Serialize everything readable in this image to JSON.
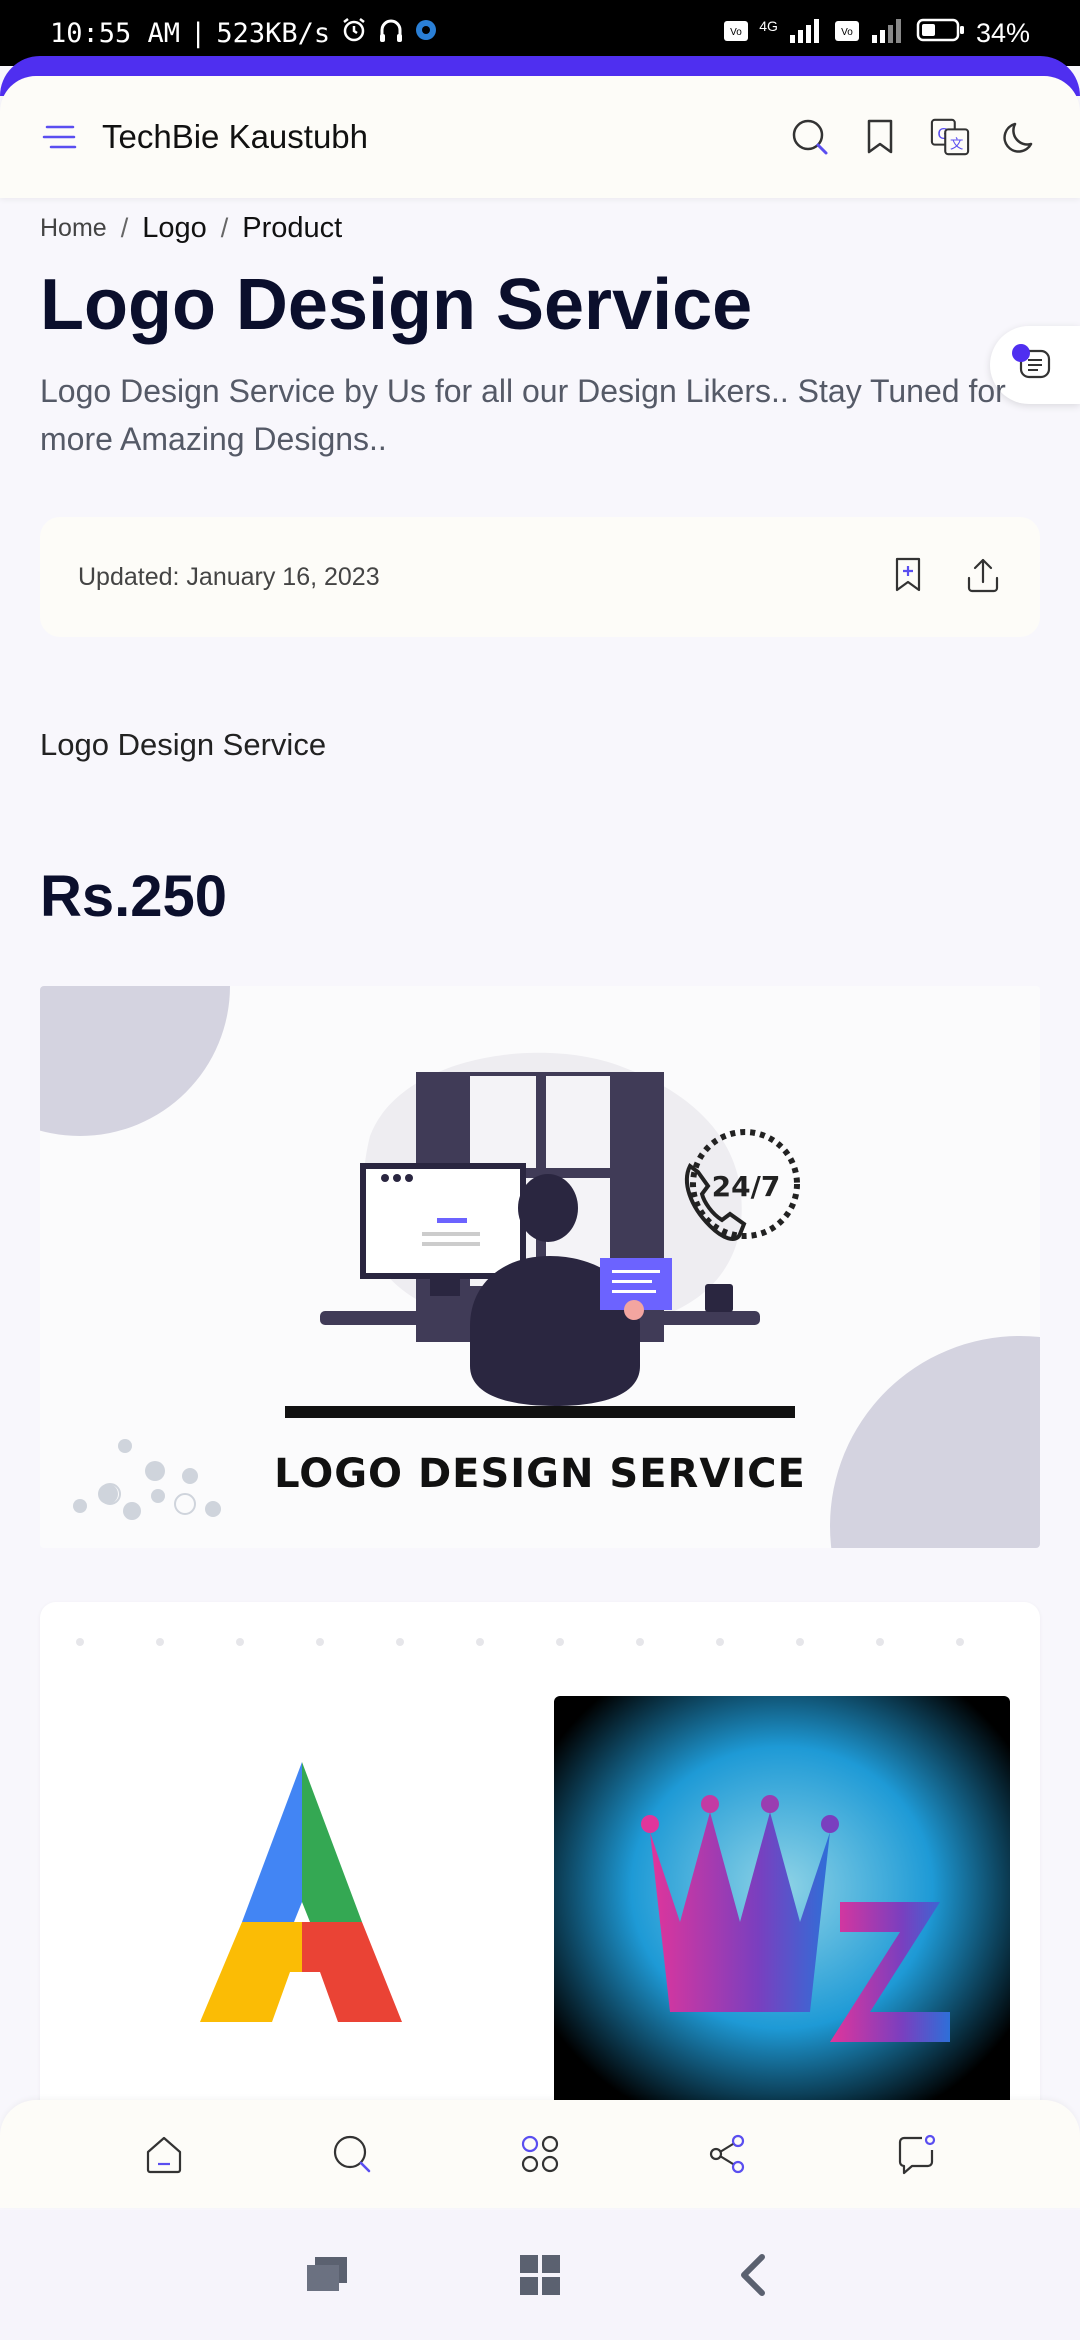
{
  "status_bar": {
    "time": "10:55 AM",
    "separator": "|",
    "net_speed": "523KB/s",
    "network_label": "4G",
    "battery": "34%"
  },
  "header": {
    "brand": "TechBie Kaustubh",
    "icons": [
      "menu-icon",
      "search-icon",
      "bookmark-icon",
      "translate-icon",
      "dark-mode-icon"
    ]
  },
  "breadcrumb": {
    "items": [
      "Home",
      "Logo",
      "Product"
    ],
    "separator": "/"
  },
  "article": {
    "title": "Logo Design Service",
    "subtitle": "Logo Design Service by Us for all our Design Likers.. Stay Tuned for more Amazing Designs..",
    "updated": "Updated: January 16, 2023",
    "product_name": "Logo Design Service",
    "price": "Rs.250",
    "hero_caption": "LOGO DESIGN SERVICE",
    "hero_badge": "24/7"
  },
  "bottom_nav": {
    "items": [
      "home-icon",
      "search-icon",
      "categories-icon",
      "share-icon",
      "comments-icon"
    ]
  },
  "colors": {
    "accent": "#4f2ff0",
    "title": "#0b0f2c",
    "surface": "#fdfcf8"
  }
}
